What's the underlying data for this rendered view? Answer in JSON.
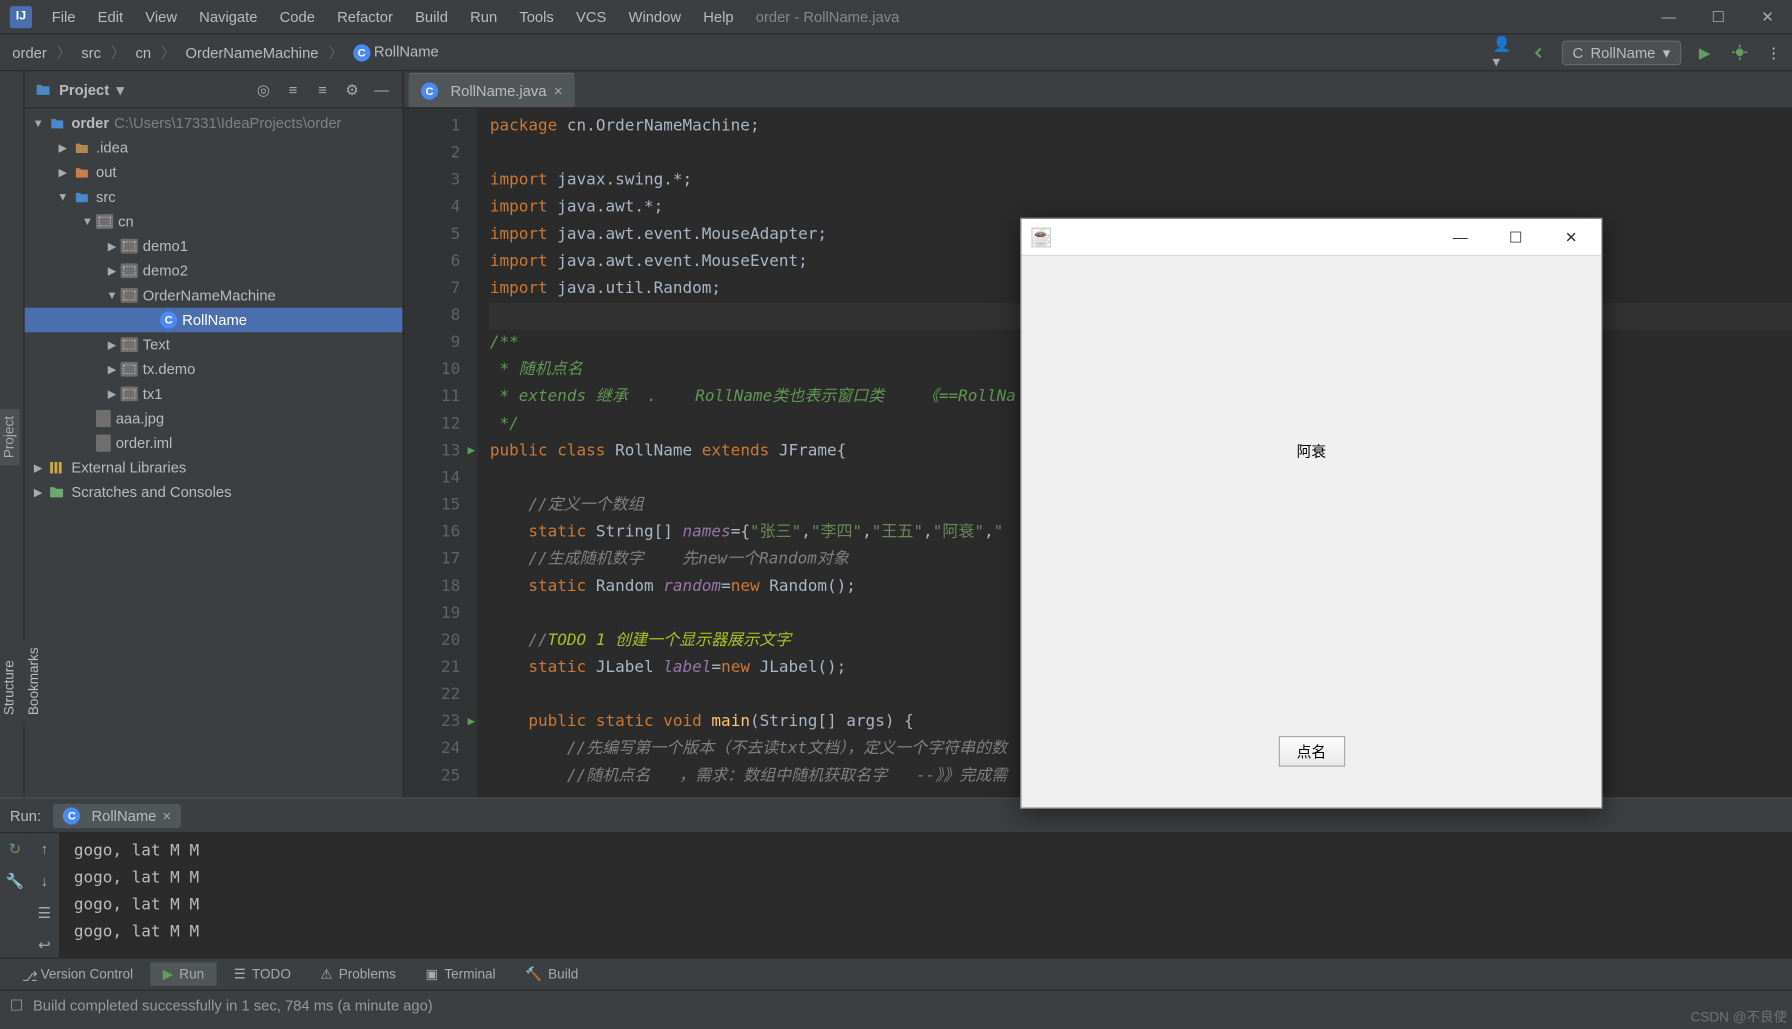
{
  "window_title": "order - RollName.java",
  "menu": [
    "File",
    "Edit",
    "View",
    "Navigate",
    "Code",
    "Refactor",
    "Build",
    "Run",
    "Tools",
    "VCS",
    "Window",
    "Help"
  ],
  "breadcrumbs": [
    "order",
    "src",
    "cn",
    "OrderNameMachine",
    "RollName"
  ],
  "run_config_name": "RollName",
  "project_panel": {
    "title": "Project",
    "tree": {
      "root": {
        "name": "order",
        "path": "C:\\Users\\17331\\IdeaProjects\\order"
      },
      "idea_folder": ".idea",
      "out_folder": "out",
      "src_folder": "src",
      "cn_pkg": "cn",
      "demo1": "demo1",
      "demo2": "demo2",
      "onm": "OrderNameMachine",
      "rollname": "RollName",
      "text": "Text",
      "txdemo": "tx.demo",
      "tx1": "tx1",
      "aaa": "aaa.jpg",
      "orderiml": "order.iml",
      "ext": "External Libraries",
      "scratch": "Scratches and Consoles"
    }
  },
  "editor": {
    "tab_name": "RollName.java",
    "lines": [
      {
        "n": 1,
        "t": "package",
        "html": "<span class='kw'>package</span> cn.OrderNameMachine;"
      },
      {
        "n": 2,
        "t": "",
        "html": ""
      },
      {
        "n": 3,
        "t": "",
        "html": "<span class='kw'>import</span> javax.swing.*;"
      },
      {
        "n": 4,
        "t": "",
        "html": "<span class='kw'>import</span> java.awt.*;"
      },
      {
        "n": 5,
        "t": "",
        "html": "<span class='kw'>import</span> java.awt.event.MouseAdapter;"
      },
      {
        "n": 6,
        "t": "",
        "html": "<span class='kw'>import</span> java.awt.event.MouseEvent;"
      },
      {
        "n": 7,
        "t": "",
        "html": "<span class='kw'>import</span> java.util.Random;"
      },
      {
        "n": 8,
        "t": "",
        "html": ""
      },
      {
        "n": 9,
        "t": "",
        "html": "<span class='doc'>/**</span>"
      },
      {
        "n": 10,
        "t": "",
        "html": "<span class='doc'> * 随机点名</span>"
      },
      {
        "n": 11,
        "t": "",
        "html": "<span class='doc'> * extends 继承  .    RollName类也表示窗口类    《==RollNa</span>"
      },
      {
        "n": 12,
        "t": "",
        "html": "<span class='doc'> */</span>"
      },
      {
        "n": 13,
        "t": "",
        "html": "<span class='kw'>public class</span> <span class='typ'>RollName</span> <span class='kw'>extends</span> JFrame{",
        "run": true
      },
      {
        "n": 14,
        "t": "",
        "html": ""
      },
      {
        "n": 15,
        "t": "",
        "html": "    <span class='cmt'>//定义一个数组</span>"
      },
      {
        "n": 16,
        "t": "",
        "html": "    <span class='kw'>static</span> String[] <span class='fld'>names</span>={<span class='str'>\"张三\"</span>,<span class='str'>\"李四\"</span>,<span class='str'>\"王五\"</span>,<span class='str'>\"阿衰\"</span>,<span class='str'>\""
      },
      {
        "n": 17,
        "t": "",
        "html": "    <span class='cmt'>//生成随机数字    先new一个Random对象</span>"
      },
      {
        "n": 18,
        "t": "",
        "html": "    <span class='kw'>static</span> Random <span class='fld'>random</span>=<span class='kw'>new</span> Random();"
      },
      {
        "n": 19,
        "t": "",
        "html": ""
      },
      {
        "n": 20,
        "t": "",
        "html": "    <span class='cmt'>//</span><span class='todo'>TODO 1 创建一个显示器展示文字</span>"
      },
      {
        "n": 21,
        "t": "",
        "html": "    <span class='kw'>static</span> JLabel <span class='fld'>label</span>=<span class='kw'>new</span> JLabel();"
      },
      {
        "n": 22,
        "t": "",
        "html": ""
      },
      {
        "n": 23,
        "t": "",
        "html": "    <span class='kw'>public static void</span> <span class='fn'>main</span>(String[] args) {",
        "run": true
      },
      {
        "n": 24,
        "t": "",
        "html": "        <span class='cmt'>//先编写第一个版本（不去读txt文档），定义一个字符串的数</span>"
      },
      {
        "n": 25,
        "t": "",
        "html": "        <span class='cmt'>//随机点名   ，需求：数组中随机获取名字   --》》完成需</span>"
      }
    ]
  },
  "run_panel": {
    "label": "Run:",
    "tab": "RollName",
    "output": [
      "gogo, lat M M",
      "gogo, lat M M",
      "gogo, lat M M",
      "gogo, lat M M"
    ]
  },
  "bottom_tabs": {
    "version": "Version Control",
    "run": "Run",
    "todo": "TODO",
    "problems": "Problems",
    "terminal": "Terminal",
    "build": "Build"
  },
  "status_bar": "Build completed successfully in 1 sec, 784 ms (a minute ago)",
  "swing": {
    "label_text": "阿衰",
    "button_text": "点名"
  },
  "side_tabs": {
    "project": "Project",
    "structure": "Structure",
    "bookmarks": "Bookmarks"
  },
  "watermark": "CSDN @不良使"
}
